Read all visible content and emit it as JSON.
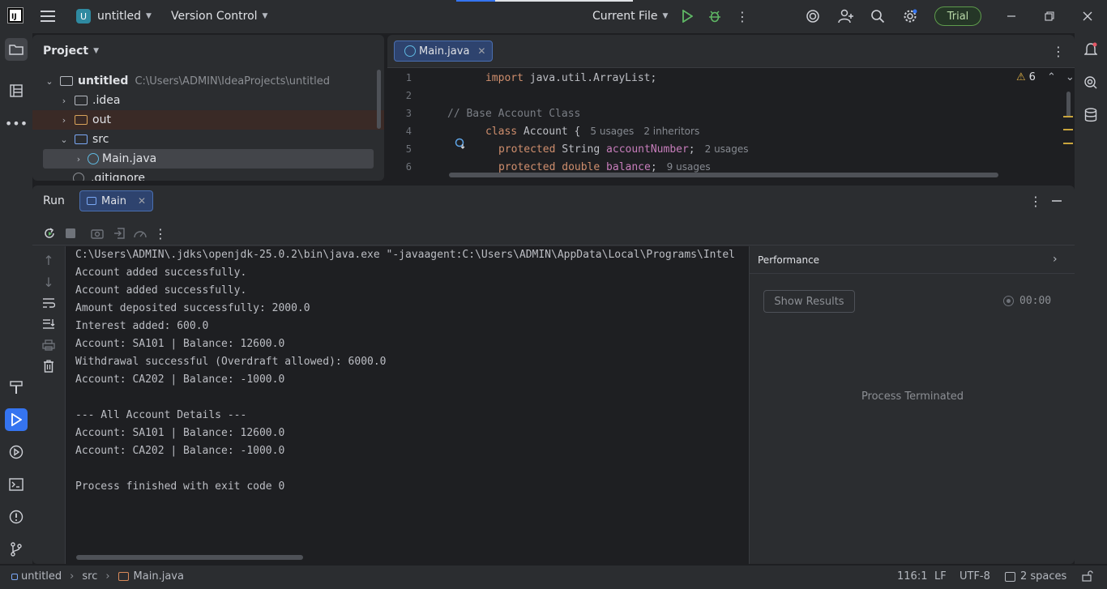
{
  "titlebar": {
    "project_badge": "U",
    "project_name": "untitled",
    "version_control": "Version Control",
    "run_config": "Current File",
    "trial": "Trial"
  },
  "project_panel": {
    "title": "Project",
    "tree": [
      {
        "name": "untitled",
        "path": "C:\\Users\\ADMIN\\IdeaProjects\\untitled"
      },
      {
        "name": ".idea"
      },
      {
        "name": "out"
      },
      {
        "name": "src"
      },
      {
        "name": "Main.java"
      },
      {
        "name": ".gitignore"
      }
    ]
  },
  "editor": {
    "tab": "Main.java",
    "warnings": "6",
    "lines": [
      {
        "n": "1"
      },
      {
        "n": "2"
      },
      {
        "n": "3"
      },
      {
        "n": "4"
      },
      {
        "n": "5"
      },
      {
        "n": "6"
      }
    ],
    "code": {
      "l1_kw": "import",
      "l1_rest": " java.util.ArrayList;",
      "l3": "// Base Account Class",
      "l4_kw": "class",
      "l4_rest": " Account {",
      "l4_hint1": "5 usages",
      "l4_hint2": "2 inheritors",
      "l5_kw": "protected",
      "l5_type": " String ",
      "l5_field": "accountNumber",
      "l5_end": ";",
      "l5_hint": "2 usages",
      "l6_kw": "protected",
      "l6_type_kw": " double ",
      "l6_field": "balance",
      "l6_end": ";",
      "l6_hint": "9 usages"
    }
  },
  "run_panel": {
    "title": "Run",
    "tab": "Main",
    "console": [
      "C:\\Users\\ADMIN\\.jdks\\openjdk-25.0.2\\bin\\java.exe \"-javaagent:C:\\Users\\ADMIN\\AppData\\Local\\Programs\\Intel",
      "Account added successfully.",
      "Account added successfully.",
      "Amount deposited successfully: 2000.0",
      "Interest added: 600.0",
      "Account: SA101 | Balance: 12600.0",
      "Withdrawal successful (Overdraft allowed): 6000.0",
      "Account: CA202 | Balance: -1000.0",
      "",
      "--- All Account Details ---",
      "Account: SA101 | Balance: 12600.0",
      "Account: CA202 | Balance: -1000.0",
      "",
      "Process finished with exit code 0"
    ],
    "performance": {
      "title": "Performance",
      "show_results": "Show Results",
      "timer": "00:00",
      "status": "Process Terminated"
    }
  },
  "statusbar": {
    "crumb_project": "untitled",
    "crumb_src": "src",
    "crumb_file": "Main.java",
    "position": "116:1",
    "line_sep": "LF",
    "encoding": "UTF-8",
    "indent": "2 spaces"
  }
}
